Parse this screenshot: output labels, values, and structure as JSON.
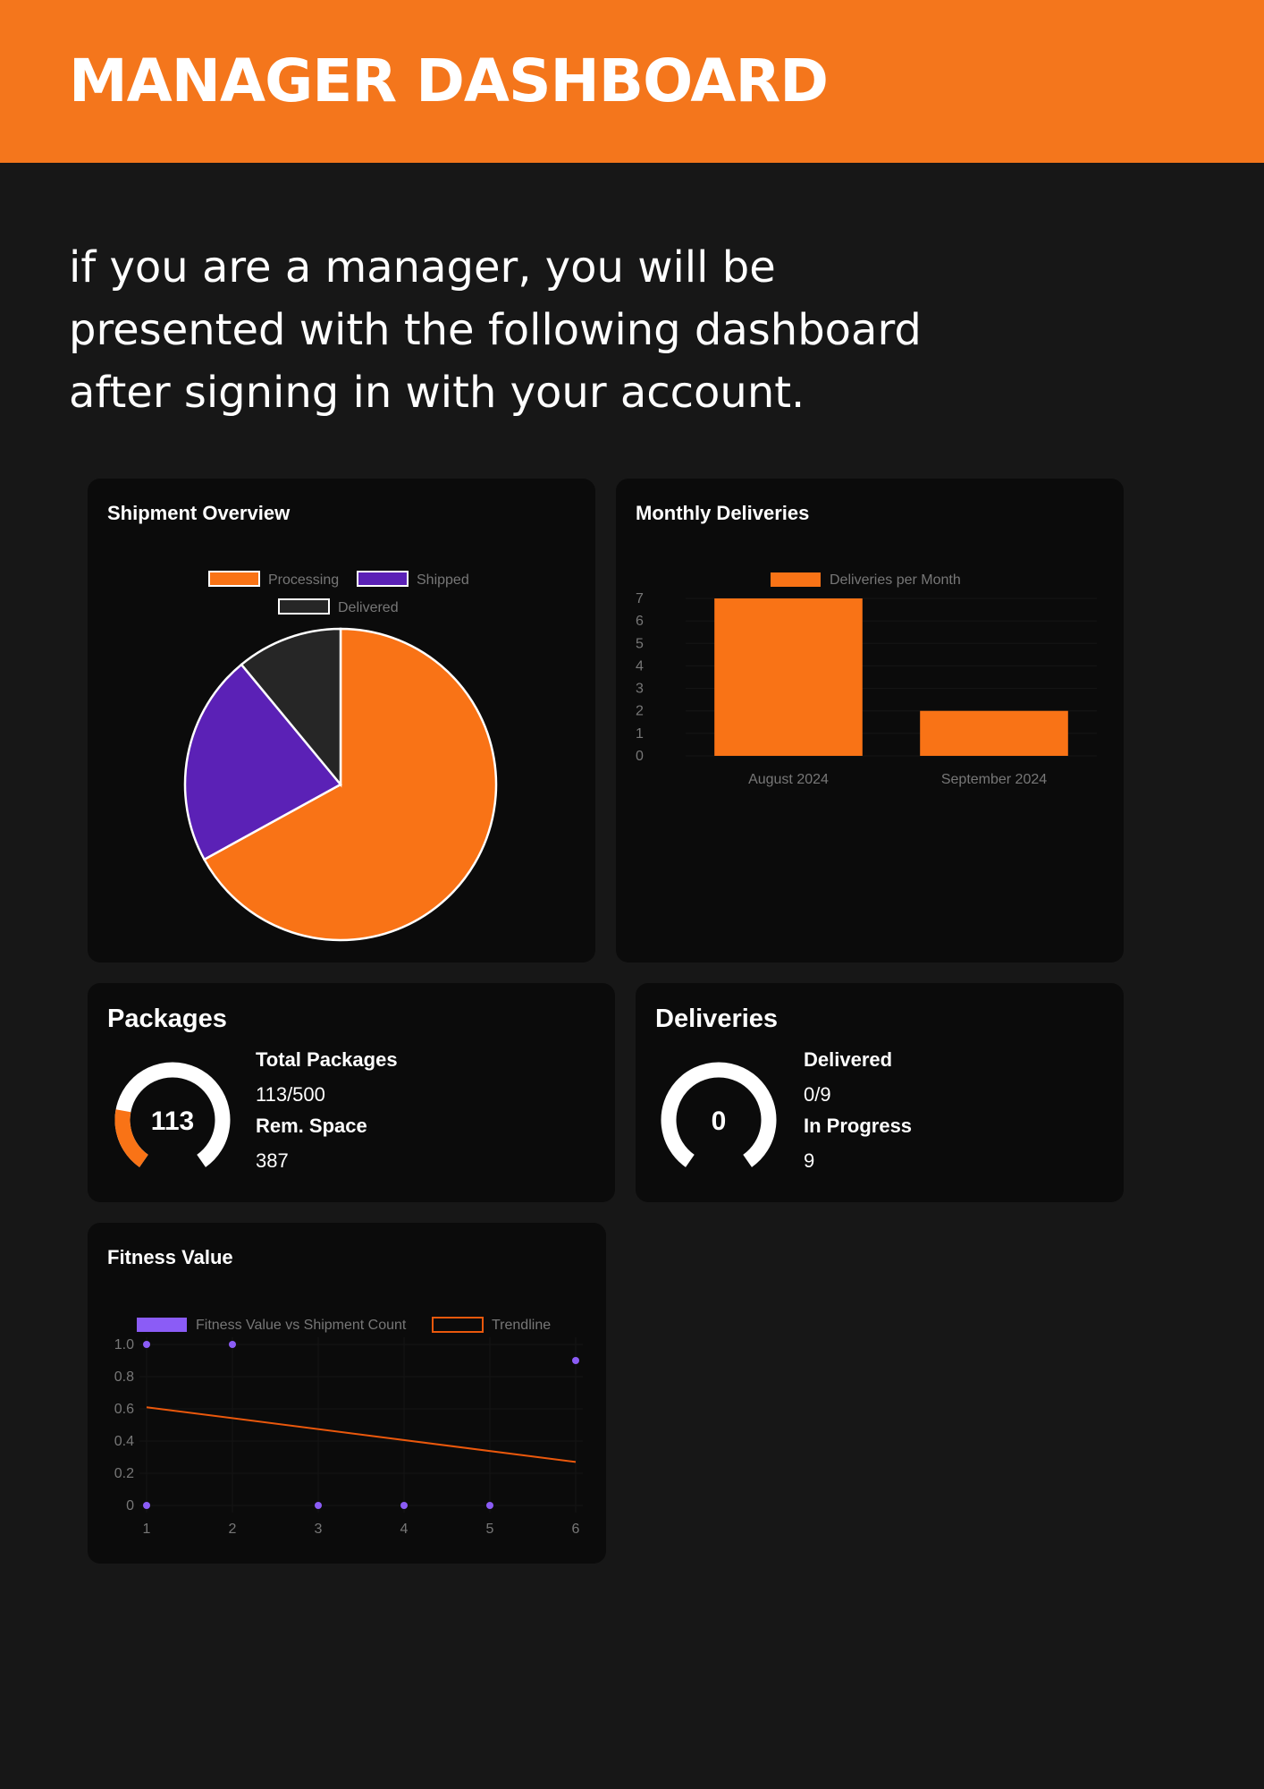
{
  "header": {
    "title": "MANAGER DASHBOARD"
  },
  "intro": {
    "line1": "if you are a manager, you will be",
    "line2": "presented with the following dashboard",
    "line3": "after signing in with your account."
  },
  "colors": {
    "accent": "#f4761c",
    "processing": "#f97316",
    "shipped": "#5b21b6",
    "delivered": "#262626",
    "scatter": "#8b5cf6",
    "trend": "#ea580c"
  },
  "shipment_overview": {
    "title": "Shipment Overview",
    "chart_data": {
      "type": "pie",
      "labels": [
        "Processing",
        "Shipped",
        "Delivered"
      ],
      "values": [
        67,
        22,
        11
      ],
      "legend": "top"
    }
  },
  "monthly_deliveries": {
    "title": "Monthly Deliveries",
    "chart_data": {
      "type": "bar",
      "categories": [
        "August 2024",
        "September 2024"
      ],
      "series": [
        {
          "name": "Deliveries per Month",
          "values": [
            7,
            2
          ]
        }
      ],
      "ylim": [
        0,
        7
      ],
      "yticks": [
        "0",
        "1",
        "2",
        "3",
        "4",
        "5",
        "6",
        "7"
      ],
      "legend": "top"
    }
  },
  "packages": {
    "title": "Packages",
    "gauge_value": "113",
    "gauge_fraction": 0.226,
    "total_label": "Total Packages",
    "total_value": "113/500",
    "space_label": "Rem. Space",
    "space_value": "387"
  },
  "deliveries": {
    "title": "Deliveries",
    "gauge_value": "0",
    "gauge_fraction": 0,
    "delivered_label": "Delivered",
    "delivered_value": "0/9",
    "progress_label": "In Progress",
    "progress_value": "9"
  },
  "fitness": {
    "title": "Fitness Value",
    "chart_data": {
      "type": "scatter",
      "series": [
        {
          "name": "Fitness Value vs Shipment Count",
          "points": [
            [
              1,
              0
            ],
            [
              1,
              1.0
            ],
            [
              2,
              1.0
            ],
            [
              3,
              0
            ],
            [
              4,
              0
            ],
            [
              5,
              0
            ],
            [
              6,
              0.9
            ]
          ]
        },
        {
          "name": "Trendline",
          "points": [
            [
              1,
              0.61
            ],
            [
              6,
              0.27
            ]
          ]
        }
      ],
      "xlim": [
        1,
        6
      ],
      "ylim": [
        0,
        1.0
      ],
      "xticks": [
        "1",
        "2",
        "3",
        "4",
        "5",
        "6"
      ],
      "yticks": [
        "0",
        "0.2",
        "0.4",
        "0.6",
        "0.8",
        "1.0"
      ],
      "legend": "top"
    }
  }
}
